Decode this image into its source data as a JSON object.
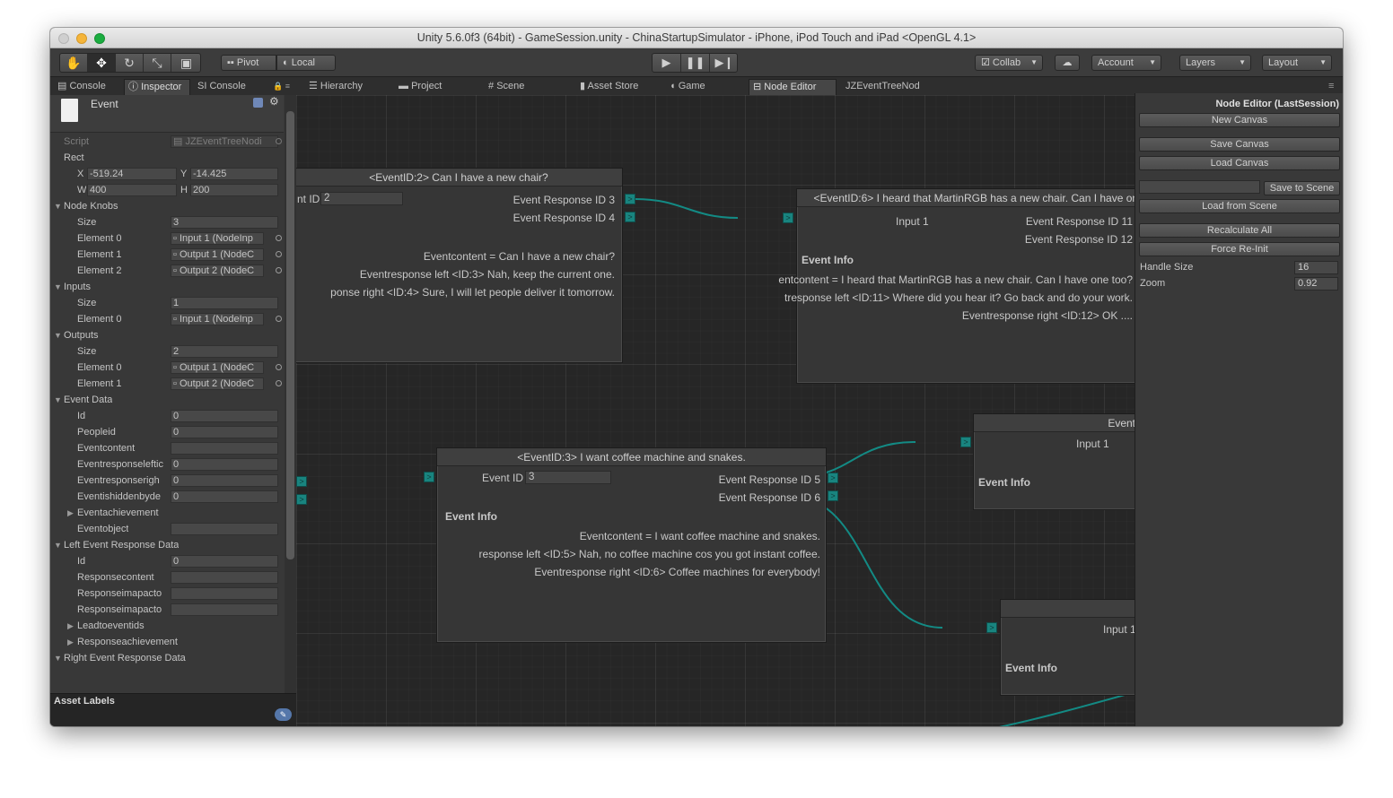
{
  "window": {
    "title": "Unity 5.6.0f3 (64bit) - GameSession.unity - ChinaStartupSimulator - iPhone, iPod Touch and iPad <OpenGL 4.1>"
  },
  "toolbar": {
    "pivot": "Pivot",
    "local": "Local",
    "collab": "Collab",
    "account": "Account",
    "layers": "Layers",
    "layout": "Layout",
    "icons": [
      "hand-icon",
      "move-icon",
      "rotate-icon",
      "scale-icon",
      "rect-tool-icon",
      "play-icon",
      "pause-icon",
      "step-icon",
      "cloud-icon"
    ]
  },
  "tabs": {
    "console": "Console",
    "inspector": "Inspector",
    "si_console": "SI Console",
    "hierarchy": "Hierarchy",
    "project": "Project",
    "scene": "Scene",
    "asset_store": "Asset Store",
    "game": "Game",
    "node_editor": "Node Editor",
    "jz_tab": "JZEventTreeNod"
  },
  "inspector": {
    "object_name": "Event",
    "script_label": "Script",
    "script_value": "JZEventTreeNodi",
    "rect_label": "Rect",
    "x_label": "X",
    "x_value": "-519.24",
    "y_label": "Y",
    "y_value": "-14.425",
    "w_label": "W",
    "w_value": "400",
    "h_label": "H",
    "h_value": "200",
    "node_knobs": "Node Knobs",
    "knobs_size_label": "Size",
    "knobs_size": "3",
    "knobs": [
      {
        "label": "Element 0",
        "value": "Input 1 (NodeInp"
      },
      {
        "label": "Element 1",
        "value": "Output 1 (NodeC"
      },
      {
        "label": "Element 2",
        "value": "Output 2 (NodeC"
      }
    ],
    "inputs": "Inputs",
    "inputs_size_label": "Size",
    "inputs_size": "1",
    "inputs_el_label": "Element 0",
    "inputs_el_value": "Input 1 (NodeInp",
    "outputs": "Outputs",
    "outputs_size_label": "Size",
    "outputs_size": "2",
    "outputs_els": [
      {
        "label": "Element 0",
        "value": "Output 1 (NodeC"
      },
      {
        "label": "Element 1",
        "value": "Output 2 (NodeC"
      }
    ],
    "event_data": "Event Data",
    "event_fields": [
      {
        "label": "Id",
        "value": "0"
      },
      {
        "label": "Peopleid",
        "value": "0"
      },
      {
        "label": "Eventcontent",
        "value": ""
      },
      {
        "label": "Eventresponseleftic",
        "value": "0"
      },
      {
        "label": "Eventresponserigh",
        "value": "0"
      },
      {
        "label": "Eventishiddenbyde",
        "value": "0"
      }
    ],
    "eventachievement": "Eventachievement",
    "eventobject": "Eventobject",
    "left_event_response": "Left Event Response Data",
    "left_fields": [
      {
        "label": "Id",
        "value": "0"
      },
      {
        "label": "Responsecontent",
        "value": ""
      },
      {
        "label": "Responseimapacto",
        "value": ""
      },
      {
        "label": "Responseimapacto",
        "value": ""
      }
    ],
    "leadtoeventids": "Leadtoeventids",
    "responseachievement": "Responseachievement",
    "right_event_response": "Right Event Response Data",
    "asset_labels": "Asset Labels"
  },
  "nodes": {
    "n2": {
      "title": "<EventID:2> Can I have a new chair?",
      "id_label": "nt ID",
      "id_value": "2",
      "resp1": "Event Response ID 3",
      "resp2": "Event Response ID 4",
      "content": "Eventcontent = Can I have a new chair?",
      "left": "Eventresponse left <ID:3> Nah, keep the current one.",
      "right": "ponse right <ID:4> Sure, I will let people deliver it tomorrow."
    },
    "n6": {
      "title": "<EventID:6> I heard that MartinRGB has a new chair. Can I have one too?",
      "input": "Input 1",
      "resp1": "Event Response ID 11",
      "resp2": "Event Response ID 12",
      "info": "Event Info",
      "content": "entcontent = I heard that MartinRGB has a new chair. Can I have one too?",
      "left": "tresponse left <ID:11> Where did you hear it? Go back and do your work.",
      "right": "Eventresponse right <ID:12> OK ...."
    },
    "n3": {
      "title": "<EventID:3> I want coffee machine and snakes.",
      "id_label": "Event ID",
      "id_value": "3",
      "resp1": "Event Response ID 5",
      "resp2": "Event Response ID 6",
      "info": "Event Info",
      "content": "Eventcontent = I want coffee machine and snakes.",
      "left": "response left <ID:5> Nah, no coffee machine cos you got instant coffee.",
      "right": "Eventresponse right <ID:6> Coffee machines for everybody!"
    },
    "n5": {
      "title": "Event",
      "input": "Input 1",
      "info": "Event Info"
    },
    "nlow": {
      "title": "E",
      "input": "Input 1",
      "info": "Event Info"
    }
  },
  "side_panel": {
    "title": "Node Editor (LastSession)",
    "new_canvas": "New Canvas",
    "save_canvas": "Save Canvas",
    "load_canvas": "Load Canvas",
    "save_to_scene": "Save to Scene",
    "load_from_scene": "Load from Scene",
    "recalculate_all": "Recalculate All",
    "force_reinit": "Force Re-Init",
    "handle_size_label": "Handle Size",
    "handle_size": "16",
    "zoom_label": "Zoom",
    "zoom": "0.92"
  },
  "colors": {
    "connection": "#138a84",
    "knob": "#19847f",
    "close": "#fc5f57",
    "minimize": "#fdbb2e",
    "maximize": "#1bc93d"
  }
}
